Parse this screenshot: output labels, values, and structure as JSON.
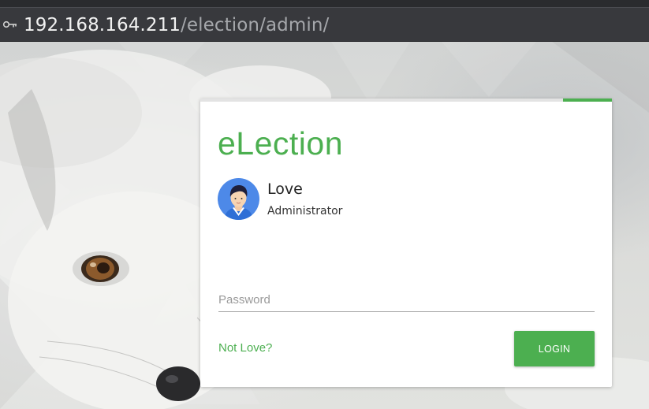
{
  "browser": {
    "url_host": "192.168.164.211",
    "url_path": "/election/admin/",
    "icon": "key-icon"
  },
  "login": {
    "brand": "eLection",
    "user_name": "Love",
    "user_role": "Administrator",
    "password_placeholder": "Password",
    "password_value": "",
    "switch_user_link": "Not Love?",
    "login_button": "LOGIN",
    "accent_color": "#4caf50"
  }
}
